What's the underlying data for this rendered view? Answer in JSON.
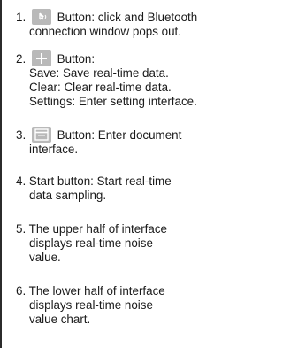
{
  "items": [
    {
      "num": "1.",
      "icon": "bluetooth-icon",
      "lines": [
        "Button: click and  Bluetooth",
        "connection window pops out."
      ]
    },
    {
      "num": "2.",
      "icon": "plus-icon",
      "lines": [
        "Button:",
        "Save: Save real-time data.",
        "Clear: Clear real-time data.",
        "Settings: Enter setting interface."
      ]
    },
    {
      "num": "3.",
      "icon": "folder-icon",
      "lines": [
        "Button: Enter document",
        "interface."
      ]
    },
    {
      "num": "4.",
      "lines": [
        "Start button: Start real-time",
        "data sampling."
      ]
    },
    {
      "num": "5.",
      "lines": [
        "The upper half of interface",
        "displays real-time noise",
        "value."
      ]
    },
    {
      "num": "6.",
      "lines": [
        "The lower half of interface",
        "displays real-time noise",
        "value chart."
      ]
    }
  ]
}
